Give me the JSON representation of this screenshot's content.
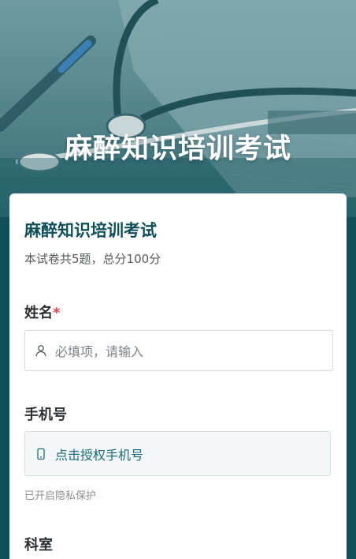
{
  "hero": {
    "title": "麻醉知识培训考试"
  },
  "form": {
    "title": "麻醉知识培训考试",
    "description": "本试卷共5题，总分100分",
    "fields": {
      "name": {
        "label": "姓名",
        "required_mark": "*",
        "placeholder": "必填项，请输入",
        "icon": "user-icon"
      },
      "phone": {
        "label": "手机号",
        "button_label": "点击授权手机号",
        "icon": "mobile-phone-icon",
        "note": "已开启隐私保护"
      },
      "department": {
        "label": "科室"
      }
    }
  },
  "colors": {
    "brand": "#0f4f58",
    "required": "#e0464c",
    "link": "#1b6b78"
  }
}
